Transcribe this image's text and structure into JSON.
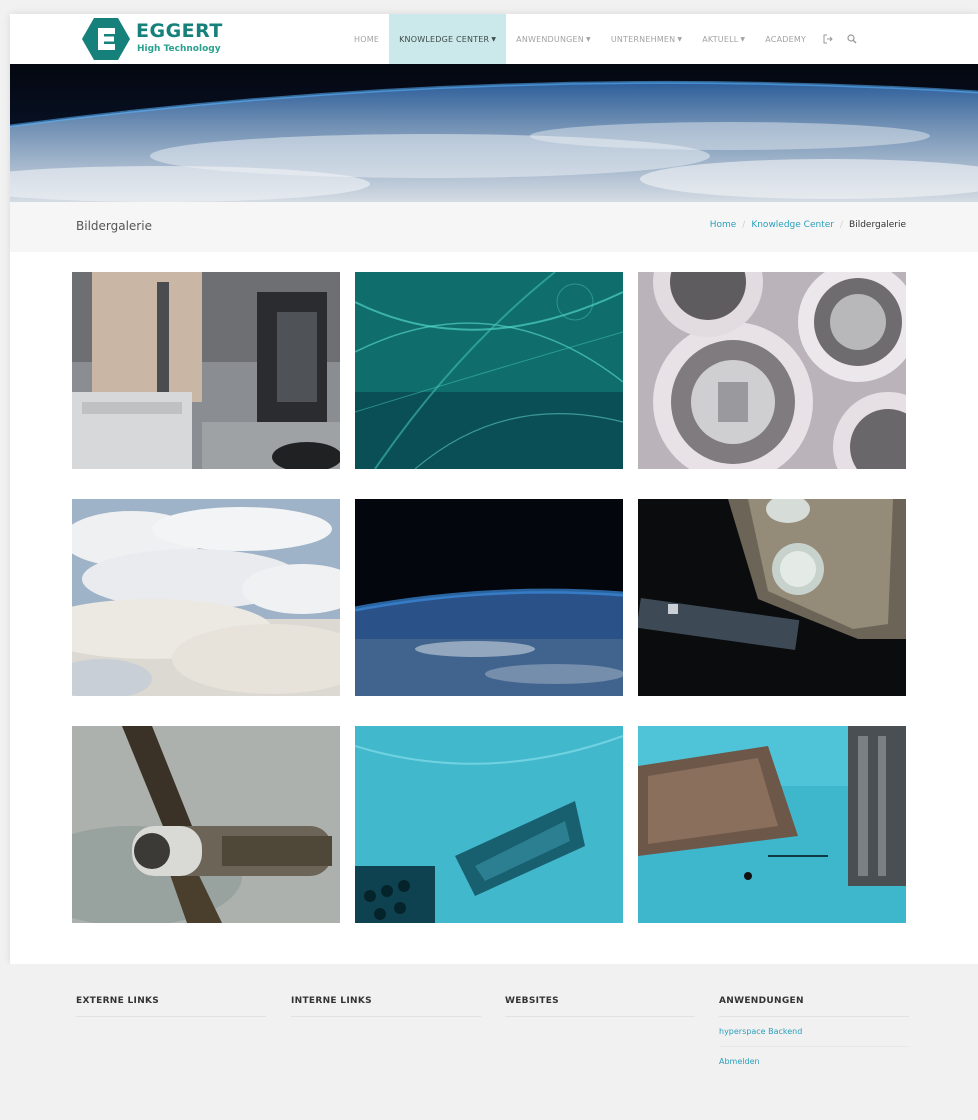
{
  "brand": {
    "name": "EGGERT",
    "tagline": "High Technology",
    "color": "#16807a"
  },
  "nav": {
    "items": [
      {
        "label": "HOME",
        "dropdown": false,
        "active": false
      },
      {
        "label": "KNOWLEDGE CENTER",
        "dropdown": true,
        "active": true
      },
      {
        "label": "ANWENDUNGEN",
        "dropdown": true,
        "active": false
      },
      {
        "label": "UNTERNEHMEN",
        "dropdown": true,
        "active": false
      },
      {
        "label": "AKTUELL",
        "dropdown": true,
        "active": false
      },
      {
        "label": "ACADEMY",
        "dropdown": false,
        "active": false
      }
    ],
    "icons": [
      "logout-icon",
      "search-icon"
    ]
  },
  "page": {
    "title": "Bildergalerie",
    "breadcrumb": [
      {
        "label": "Home",
        "link": true
      },
      {
        "label": "Knowledge Center",
        "link": true
      },
      {
        "label": "Bildergalerie",
        "link": false
      }
    ]
  },
  "gallery": {
    "images": [
      {
        "name": "gallery-image-laboratory-microscope"
      },
      {
        "name": "gallery-image-teal-fibers"
      },
      {
        "name": "gallery-image-circular-components"
      },
      {
        "name": "gallery-image-cloud-layer"
      },
      {
        "name": "gallery-image-earth-horizon"
      },
      {
        "name": "gallery-image-spacecraft-module"
      },
      {
        "name": "gallery-image-satellite-orbit"
      },
      {
        "name": "gallery-image-cyan-structure"
      },
      {
        "name": "gallery-image-cyan-machinery"
      }
    ]
  },
  "footer": {
    "columns": [
      {
        "heading": "EXTERNE LINKS",
        "links": []
      },
      {
        "heading": "INTERNE LINKS",
        "links": []
      },
      {
        "heading": "WEBSITES",
        "links": []
      },
      {
        "heading": "ANWENDUNGEN",
        "links": [
          "hyperspace Backend",
          "Abmelden"
        ]
      }
    ]
  },
  "colors": {
    "accent": "#2a9fbc",
    "active_nav_bg": "#cbe9ea",
    "page_bg": "#f1f1f1"
  }
}
